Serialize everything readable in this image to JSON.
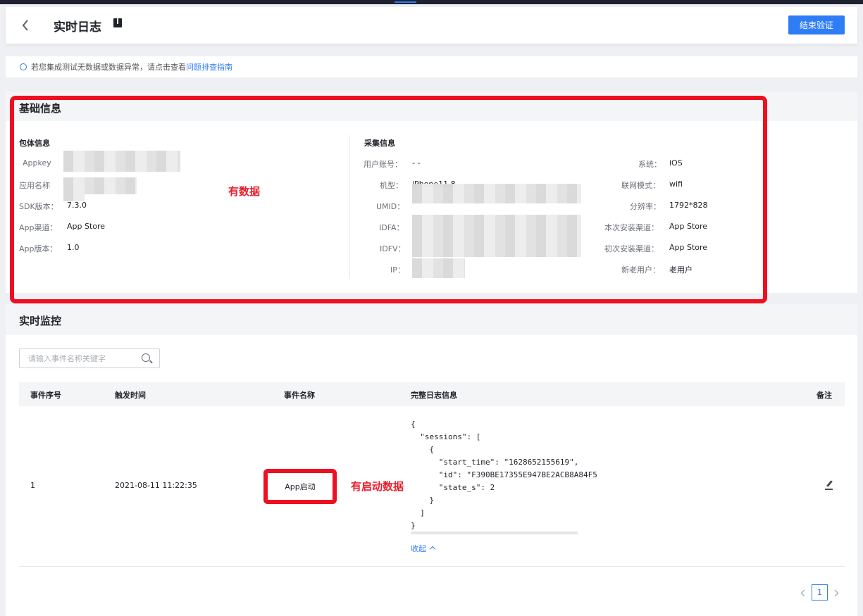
{
  "header": {
    "title": "实时日志",
    "end_button": "结束验证"
  },
  "notice": {
    "text": "若您集成测试无数据或数据异常，请点击查看",
    "link": "问题排查指南"
  },
  "basic_info": {
    "title": "基础信息",
    "package": {
      "title": "包体信息",
      "fields": [
        {
          "label": "Appkey",
          "value": ""
        },
        {
          "label": "应用名称",
          "value": ""
        },
        {
          "label": "SDK版本：",
          "value": "7.3.0"
        },
        {
          "label": "App渠道：",
          "value": "App Store"
        },
        {
          "label": "App版本：",
          "value": "1.0"
        }
      ]
    },
    "collect": {
      "title": "采集信息",
      "fields_left": [
        {
          "label": "用户账号：",
          "value": "- -"
        },
        {
          "label": "机型：",
          "value": "iPhone11,8"
        },
        {
          "label": "UMID：",
          "value": ""
        },
        {
          "label": "IDFA：",
          "value": ""
        },
        {
          "label": "IDFV：",
          "value": ""
        },
        {
          "label": "IP：",
          "value": ""
        }
      ],
      "fields_right": [
        {
          "label": "系统：",
          "value": "iOS"
        },
        {
          "label": "联网模式：",
          "value": "wifi"
        },
        {
          "label": "分辨率：",
          "value": "1792*828"
        },
        {
          "label": "本次安装渠道：",
          "value": "App Store"
        },
        {
          "label": "初次安装渠道：",
          "value": "App Store"
        },
        {
          "label": "新老用户：",
          "value": "老用户"
        }
      ]
    }
  },
  "annotations": {
    "has_data": "有数据",
    "has_start_data": "有启动数据"
  },
  "monitor": {
    "title": "实时监控",
    "search_placeholder": "请输入事件名称关键字",
    "columns": [
      "事件序号",
      "触发时间",
      "事件名称",
      "完整日志信息",
      "备注"
    ],
    "rows": [
      {
        "index": "1",
        "time": "2021-08-11 11:22:35",
        "event": "App启动",
        "log": "{\n  \"sessions\": [\n    {\n      \"start_time\": \"1628652155619\",\n      \"id\": \"F390BE17355E947BE2ACB8A84F5\n      \"state_s\": 2\n    }\n  ]\n}",
        "collapse": "收起"
      }
    ]
  },
  "pagination": {
    "current": "1"
  },
  "colors": {
    "primary": "#2f7df6",
    "annotation_red": "#ee1021"
  }
}
